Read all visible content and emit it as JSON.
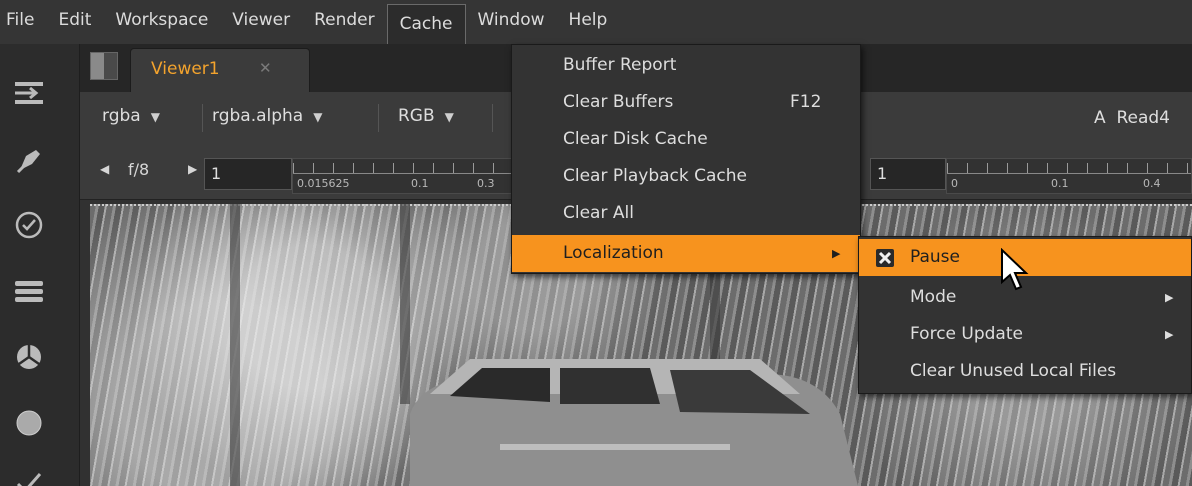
{
  "menubar": {
    "items": [
      "File",
      "Edit",
      "Workspace",
      "Viewer",
      "Render",
      "Cache",
      "Window",
      "Help"
    ]
  },
  "tab": {
    "label": "Viewer1",
    "close": "✕"
  },
  "channels": {
    "layer": "rgba",
    "alpha": "rgba.alpha",
    "display": "RGB",
    "input_prefix": "A",
    "input_node": "Read4"
  },
  "frame": {
    "fstop": "f/8",
    "frame_value": "1",
    "gain_ticks": [
      "0.015625",
      "0.1",
      "0.3"
    ],
    "gamma_value": "1",
    "gamma_ticks": [
      "0",
      "0.1",
      "0.4"
    ]
  },
  "cache_menu": {
    "items": [
      {
        "label": "Buffer Report",
        "shortcut": ""
      },
      {
        "label": "Clear Buffers",
        "shortcut": "F12"
      },
      {
        "label": "Clear Disk Cache",
        "shortcut": ""
      },
      {
        "label": "Clear Playback Cache",
        "shortcut": ""
      },
      {
        "label": "Clear All",
        "shortcut": ""
      },
      {
        "label": "Localization",
        "shortcut": ""
      }
    ],
    "highlighted": "Localization"
  },
  "localization_menu": {
    "items": [
      {
        "label": "Pause",
        "checked": true
      },
      {
        "label": "Mode",
        "submenu": true
      },
      {
        "label": "Force Update",
        "submenu": true
      },
      {
        "label": "Clear Unused Local Files",
        "submenu": false
      }
    ],
    "highlighted": "Pause"
  },
  "colors": {
    "accent": "#f7931e",
    "tab_label": "#f3a32d",
    "menu_bg": "#333333"
  }
}
